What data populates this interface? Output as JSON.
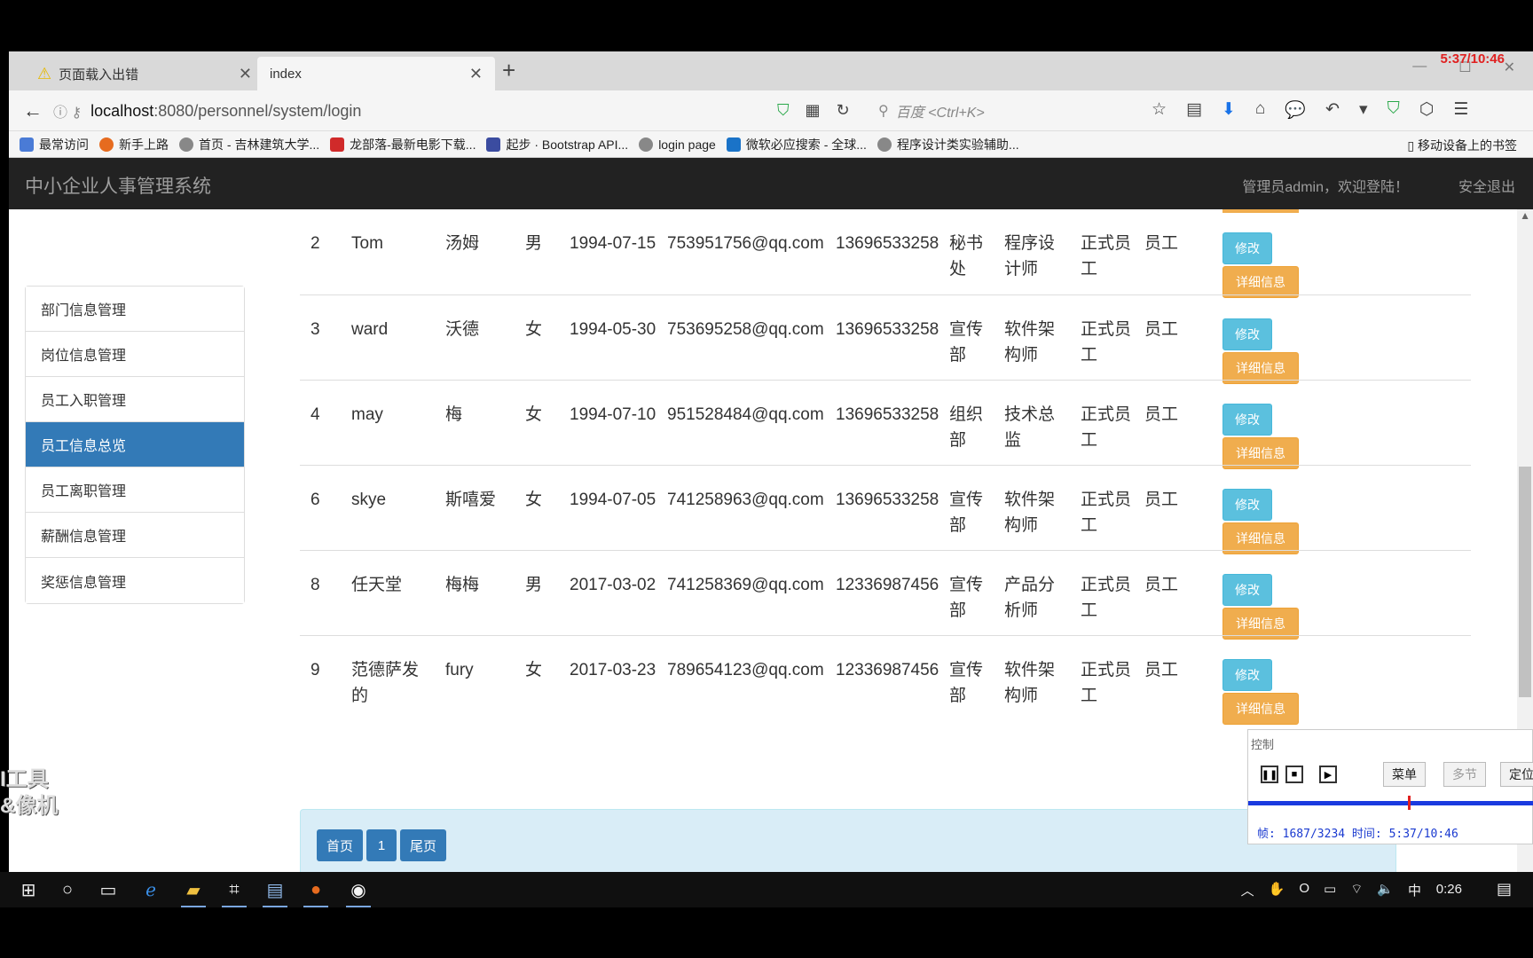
{
  "browser": {
    "tabs": [
      {
        "label": "页面载入出错",
        "active": false
      },
      {
        "label": "index",
        "active": true
      }
    ],
    "rec_timestamp": "5:37/10:46",
    "url_host": "localhost",
    "url_path": ":8080/personnel/system/login",
    "search_placeholder": "百度 <Ctrl+K>",
    "bookmarks": [
      {
        "label": "最常访问",
        "color": "#4a7bd6"
      },
      {
        "label": "新手上路",
        "color": "#e66b1f"
      },
      {
        "label": "首页 - 吉林建筑大学...",
        "color": "#888888"
      },
      {
        "label": "龙部落-最新电影下载...",
        "color": "#d02a2a"
      },
      {
        "label": "起步 · Bootstrap API...",
        "color": "#3b4ca0"
      },
      {
        "label": "login page",
        "color": "#888888"
      },
      {
        "label": "微软必应搜索 - 全球...",
        "color": "#1a73c8"
      },
      {
        "label": "程序设计类实验辅助...",
        "color": "#888888"
      }
    ],
    "mobile_bookmarks": "移动设备上的书签"
  },
  "app": {
    "brand": "中小企业人事管理系统",
    "welcome": "管理员admin，欢迎登陆！",
    "logout": "安全退出",
    "sidebar": [
      {
        "label": "部门信息管理",
        "active": false
      },
      {
        "label": "岗位信息管理",
        "active": false
      },
      {
        "label": "员工入职管理",
        "active": false
      },
      {
        "label": "员工信息总览",
        "active": true
      },
      {
        "label": "员工离职管理",
        "active": false
      },
      {
        "label": "薪酬信息管理",
        "active": false
      },
      {
        "label": "奖惩信息管理",
        "active": false
      }
    ],
    "rows": [
      {
        "id": "2",
        "name": "Tom",
        "cn": "汤姆",
        "sex": "男",
        "birth": "1994-07-15",
        "email": "753951756@qq.com",
        "phone": "13696533258",
        "dept": "秘书处",
        "job": "程序设计师",
        "type": "正式员工",
        "role": "员工"
      },
      {
        "id": "3",
        "name": "ward",
        "cn": "沃德",
        "sex": "女",
        "birth": "1994-05-30",
        "email": "753695258@qq.com",
        "phone": "13696533258",
        "dept": "宣传部",
        "job": "软件架构师",
        "type": "正式员工",
        "role": "员工"
      },
      {
        "id": "4",
        "name": "may",
        "cn": "梅",
        "sex": "女",
        "birth": "1994-07-10",
        "email": "951528484@qq.com",
        "phone": "13696533258",
        "dept": "组织部",
        "job": "技术总监",
        "type": "正式员工",
        "role": "员工"
      },
      {
        "id": "6",
        "name": "skye",
        "cn": "斯嘻爱",
        "sex": "女",
        "birth": "1994-07-05",
        "email": "741258963@qq.com",
        "phone": "13696533258",
        "dept": "宣传部",
        "job": "软件架构师",
        "type": "正式员工",
        "role": "员工"
      },
      {
        "id": "8",
        "name": "任天堂",
        "cn": "梅梅",
        "sex": "男",
        "birth": "2017-03-02",
        "email": "741258369@qq.com",
        "phone": "12336987456",
        "dept": "宣传部",
        "job": "产品分析师",
        "type": "正式员工",
        "role": "员工"
      },
      {
        "id": "9",
        "name": "范德萨发的",
        "cn": "fury",
        "sex": "女",
        "birth": "2017-03-23",
        "email": "789654123@qq.com",
        "phone": "12336987456",
        "dept": "宣传部",
        "job": "软件架构师",
        "type": "正式员工",
        "role": "员工"
      }
    ],
    "edit_label": "修改",
    "detail_label": "详细信息",
    "pager": {
      "first": "首页",
      "page": "1",
      "last": "尾页"
    }
  },
  "recorder": {
    "title": "控制",
    "menu": "菜单",
    "multi": "多节",
    "locate": "定位",
    "frame_label": "帧: 1687/3234 时间: 5:37/10:46"
  },
  "watermark": [
    "I工具",
    "&像机"
  ],
  "taskbar": {
    "clock": "0:26",
    "ime": "中"
  }
}
